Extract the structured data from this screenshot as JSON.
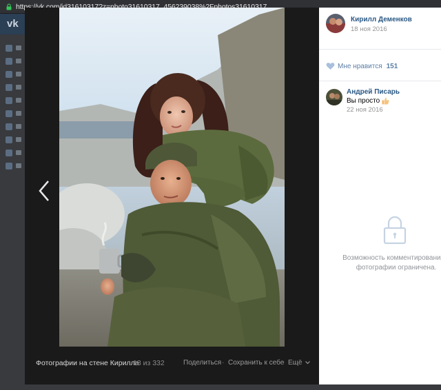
{
  "browser": {
    "url": "https://vk.com/id31610317?z=photo31610317_456239038%2Fphotos31610317"
  },
  "viewer": {
    "album_title": "Фотографии на стене Кирилла",
    "counter": "13 из 332",
    "share_label": "Поделиться",
    "save_label": "Сохранить к себе",
    "more_label": "Ещё",
    "separator": "·"
  },
  "author": {
    "name": "Кирилл Деменков",
    "date": "18 ноя 2016"
  },
  "likes": {
    "label": "Мне нравится",
    "count": "151"
  },
  "comment": {
    "author": "Андрей Писарь",
    "text": "Вы просто",
    "emoji": "thumbs-up-emoji",
    "date": "22 ноя 2016"
  },
  "restricted_message": {
    "line1": "Возможность комментирования э",
    "line2": "фотографии ограничена."
  },
  "colors": {
    "link": "#2a5885",
    "like": "#5b7fa6",
    "viewer_bg": "#1a1a1a",
    "header": "#2b3f55"
  }
}
